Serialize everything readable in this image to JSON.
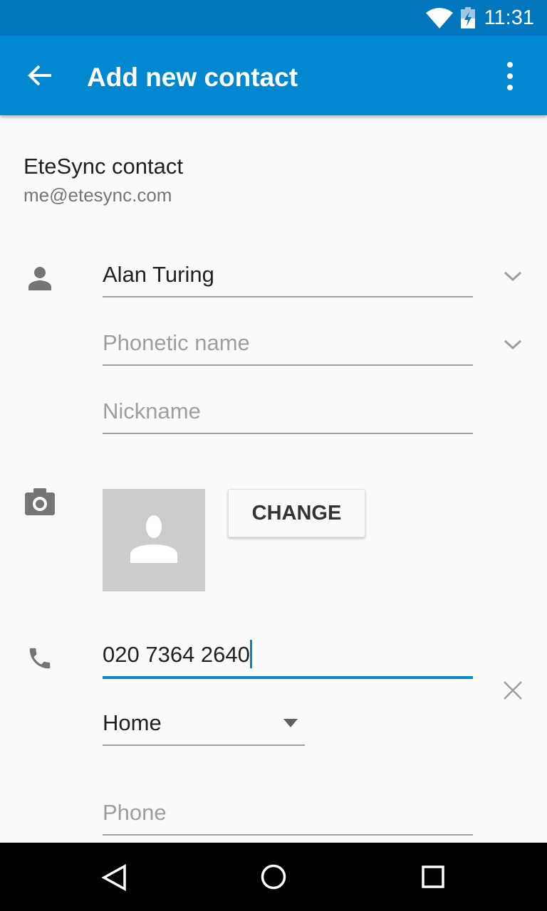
{
  "status": {
    "time": "11:31",
    "icons": [
      "wifi-icon",
      "battery-charging-icon"
    ]
  },
  "toolbar": {
    "title": "Add new contact",
    "back": "arrow-back-icon",
    "menu": "more-vert-icon"
  },
  "account": {
    "type": "EteSync contact",
    "email": "me@etesync.com"
  },
  "name": {
    "value": "Alan Turing",
    "phonetic_placeholder": "Phonetic name",
    "nickname_placeholder": "Nickname"
  },
  "photo": {
    "change_label": "CHANGE"
  },
  "phone": {
    "value": "020 7364 2640",
    "type": "Home",
    "new_placeholder": "Phone"
  },
  "colors": {
    "primary": "#0288d1",
    "status": "#0277bd",
    "accent": "#0288d1"
  }
}
